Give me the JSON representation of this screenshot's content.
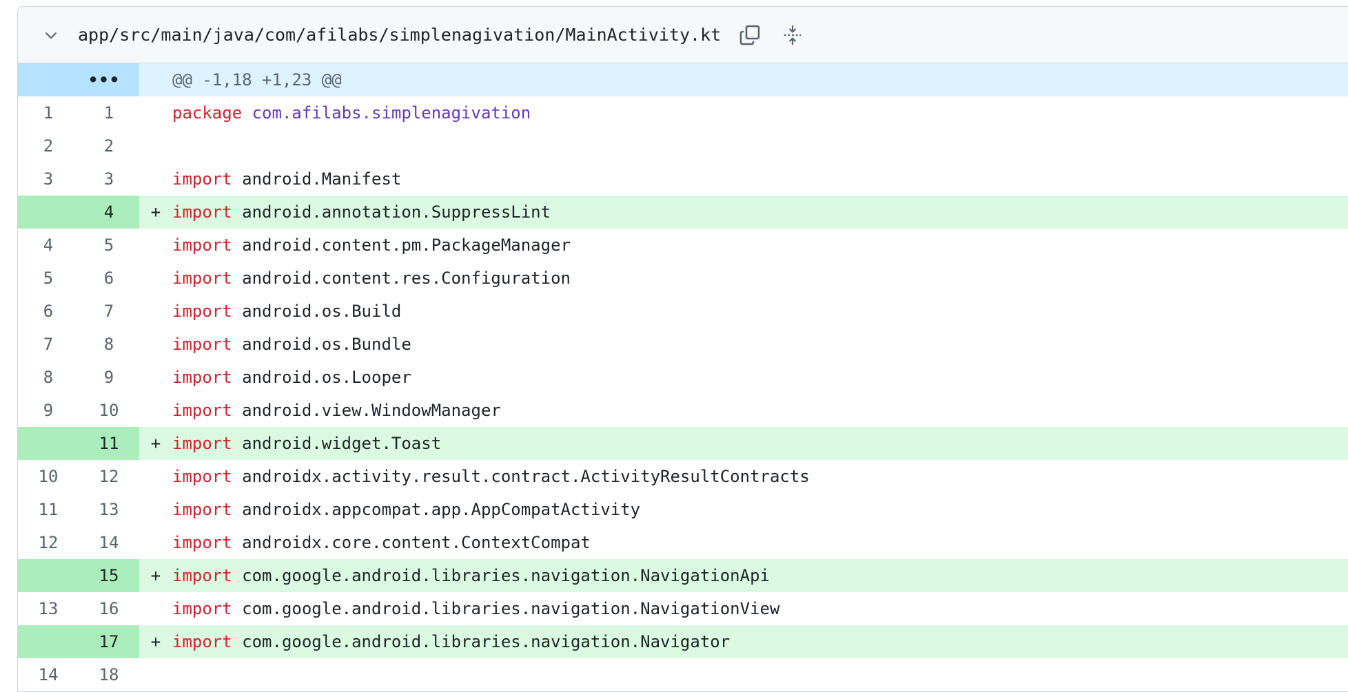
{
  "file": {
    "path": "app/src/main/java/com/afilabs/simplenagivation/MainActivity.kt",
    "toggle_icon": "chevron-down-icon",
    "copy_icon": "copy-icon",
    "expand_icon": "unfold-icon"
  },
  "hunk": {
    "expand_label": "•••",
    "header": "@@ -1,18 +1,23 @@"
  },
  "colors": {
    "keyword": "#cf222e",
    "package_name": "#6639ba",
    "added_bg": "#dafbe1",
    "added_num_bg": "#aceebb",
    "hunk_bg": "#ddf4ff"
  },
  "lines": [
    {
      "old": "1",
      "new": "1",
      "type": "context",
      "marker": "",
      "keyword": "package",
      "text": "com.afilabs.simplenagivation"
    },
    {
      "old": "2",
      "new": "2",
      "type": "context",
      "marker": "",
      "keyword": "",
      "text": ""
    },
    {
      "old": "3",
      "new": "3",
      "type": "context",
      "marker": "",
      "keyword": "import",
      "text": "android.Manifest"
    },
    {
      "old": "",
      "new": "4",
      "type": "add",
      "marker": "+",
      "keyword": "import",
      "text": "android.annotation.SuppressLint"
    },
    {
      "old": "4",
      "new": "5",
      "type": "context",
      "marker": "",
      "keyword": "import",
      "text": "android.content.pm.PackageManager"
    },
    {
      "old": "5",
      "new": "6",
      "type": "context",
      "marker": "",
      "keyword": "import",
      "text": "android.content.res.Configuration"
    },
    {
      "old": "6",
      "new": "7",
      "type": "context",
      "marker": "",
      "keyword": "import",
      "text": "android.os.Build"
    },
    {
      "old": "7",
      "new": "8",
      "type": "context",
      "marker": "",
      "keyword": "import",
      "text": "android.os.Bundle"
    },
    {
      "old": "8",
      "new": "9",
      "type": "context",
      "marker": "",
      "keyword": "import",
      "text": "android.os.Looper"
    },
    {
      "old": "9",
      "new": "10",
      "type": "context",
      "marker": "",
      "keyword": "import",
      "text": "android.view.WindowManager"
    },
    {
      "old": "",
      "new": "11",
      "type": "add",
      "marker": "+",
      "keyword": "import",
      "text": "android.widget.Toast"
    },
    {
      "old": "10",
      "new": "12",
      "type": "context",
      "marker": "",
      "keyword": "import",
      "text": "androidx.activity.result.contract.ActivityResultContracts"
    },
    {
      "old": "11",
      "new": "13",
      "type": "context",
      "marker": "",
      "keyword": "import",
      "text": "androidx.appcompat.app.AppCompatActivity"
    },
    {
      "old": "12",
      "new": "14",
      "type": "context",
      "marker": "",
      "keyword": "import",
      "text": "androidx.core.content.ContextCompat"
    },
    {
      "old": "",
      "new": "15",
      "type": "add",
      "marker": "+",
      "keyword": "import",
      "text": "com.google.android.libraries.navigation.NavigationApi"
    },
    {
      "old": "13",
      "new": "16",
      "type": "context",
      "marker": "",
      "keyword": "import",
      "text": "com.google.android.libraries.navigation.NavigationView"
    },
    {
      "old": "",
      "new": "17",
      "type": "add",
      "marker": "+",
      "keyword": "import",
      "text": "com.google.android.libraries.navigation.Navigator"
    },
    {
      "old": "14",
      "new": "18",
      "type": "context",
      "marker": "",
      "keyword": "",
      "text": ""
    }
  ]
}
